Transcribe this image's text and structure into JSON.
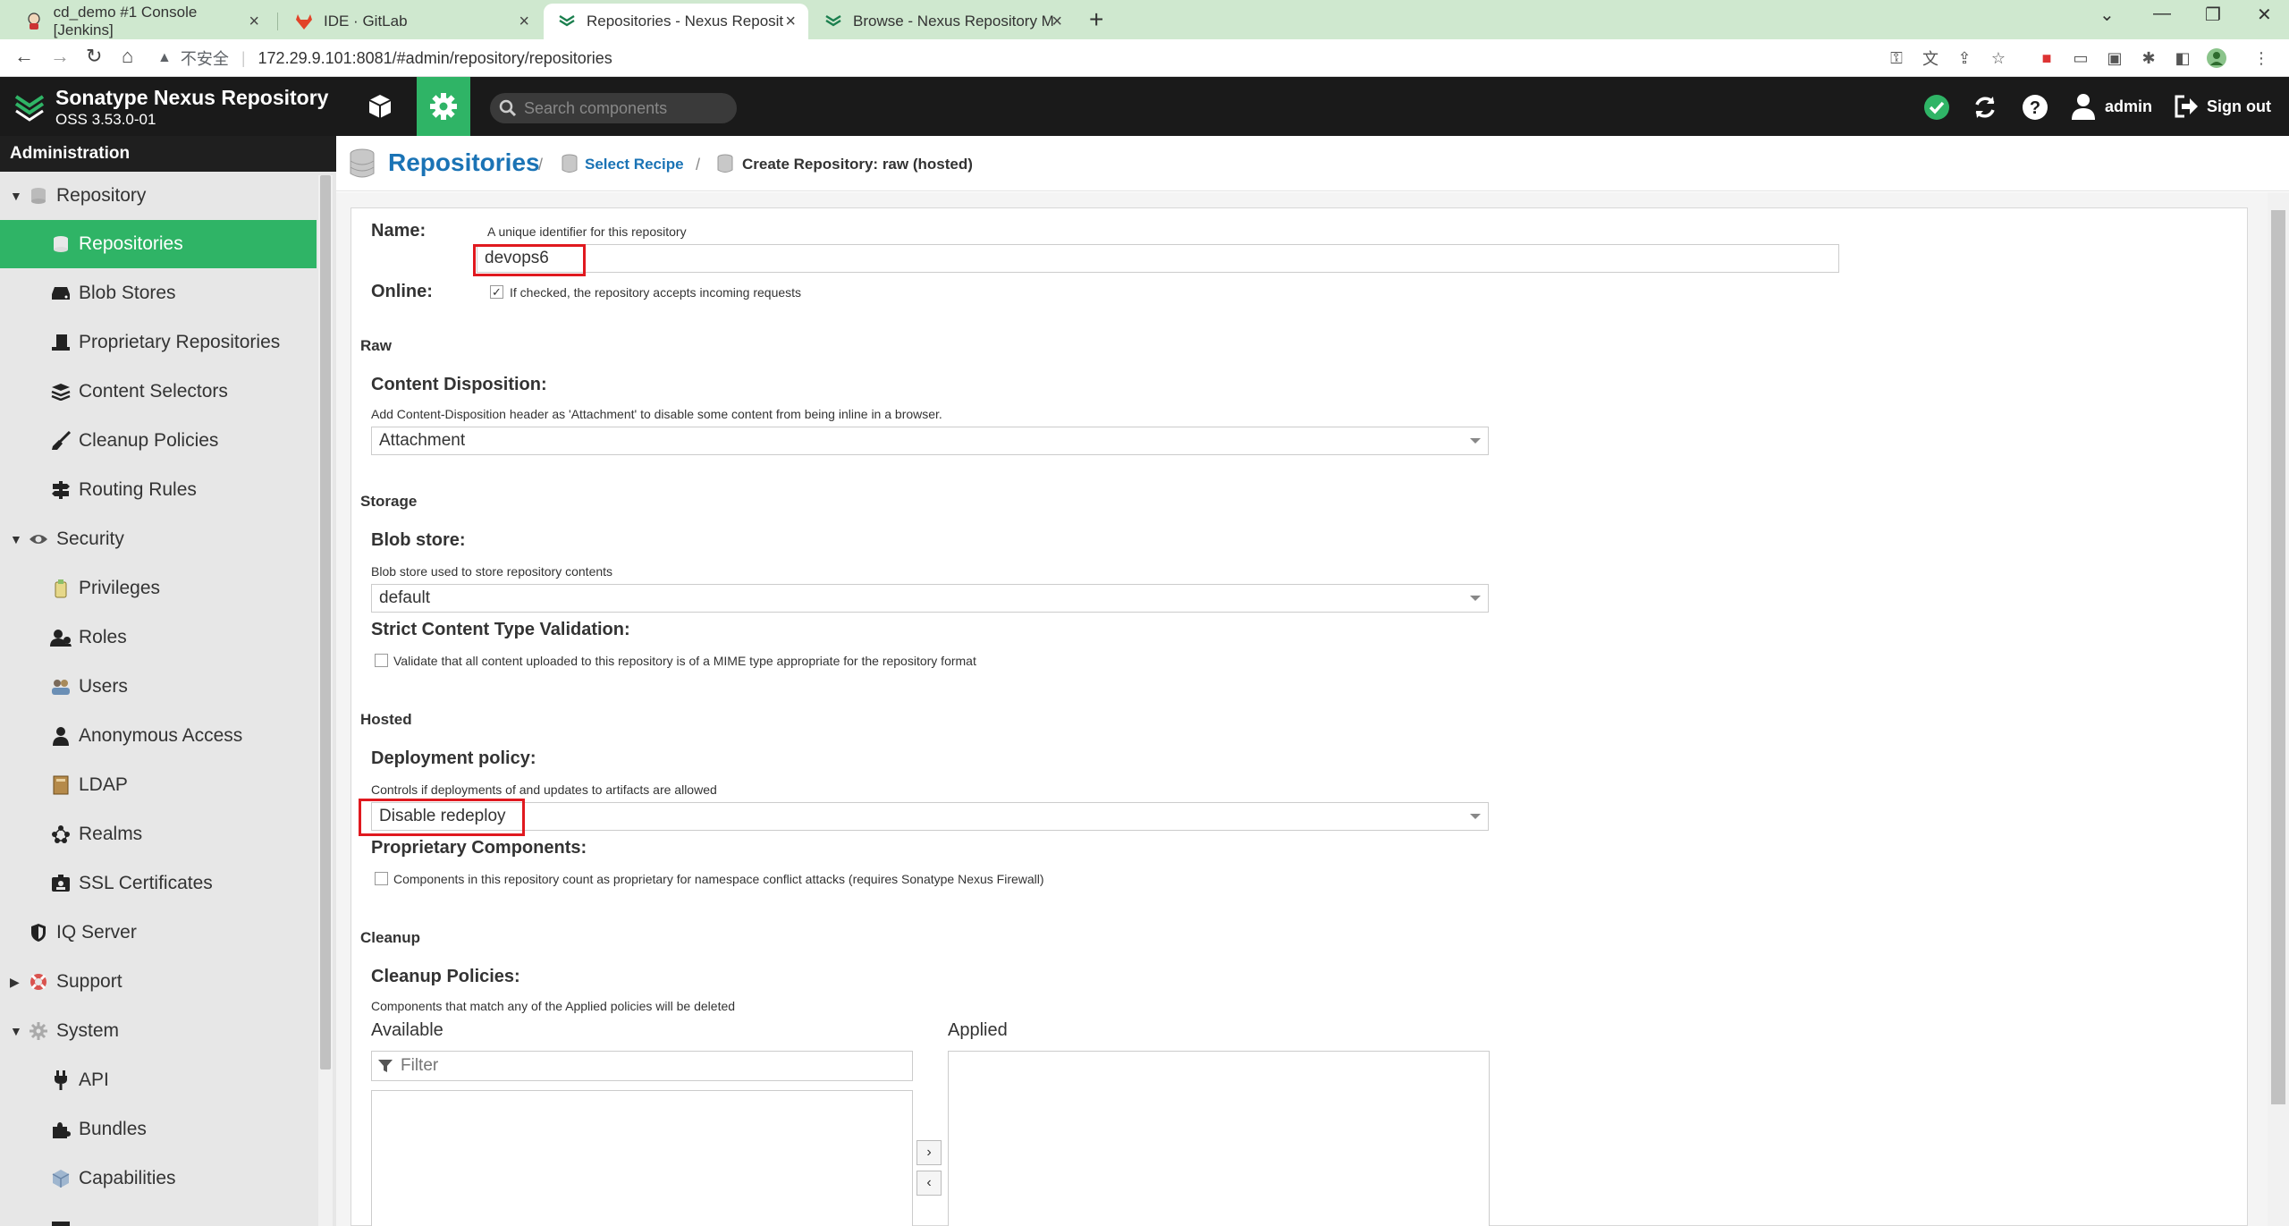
{
  "browser": {
    "tabs": [
      {
        "label": "cd_demo #1 Console [Jenkins]",
        "icon": "jenkins-icon",
        "active": false
      },
      {
        "label": "IDE · GitLab",
        "icon": "gitlab-icon",
        "active": false
      },
      {
        "label": "Repositories - Nexus Reposito",
        "icon": "nexus-icon",
        "active": true
      },
      {
        "label": "Browse - Nexus Repository Ma",
        "icon": "nexus-icon",
        "active": false
      }
    ],
    "url_prefix": "不安全",
    "url": "172.29.9.101:8081/#admin/repository/repositories"
  },
  "header": {
    "title": "Sonatype Nexus Repository",
    "version": "OSS 3.53.0-01",
    "search_placeholder": "Search components",
    "user": "admin",
    "signout": "Sign out"
  },
  "sidebar": {
    "header": "Administration",
    "items": [
      {
        "label": "Repository",
        "level": 1,
        "expanded": true,
        "icon": "database-icon"
      },
      {
        "label": "Repositories",
        "level": 2,
        "active": true,
        "icon": "database-icon"
      },
      {
        "label": "Blob Stores",
        "level": 2,
        "icon": "hard-drive-icon"
      },
      {
        "label": "Proprietary Repositories",
        "level": 2,
        "icon": "tophat-icon"
      },
      {
        "label": "Content Selectors",
        "level": 2,
        "icon": "layers-icon"
      },
      {
        "label": "Cleanup Policies",
        "level": 2,
        "icon": "broom-icon"
      },
      {
        "label": "Routing Rules",
        "level": 2,
        "icon": "signpost-icon"
      },
      {
        "label": "Security",
        "level": 1,
        "expanded": true,
        "icon": "eye-icon"
      },
      {
        "label": "Privileges",
        "level": 2,
        "icon": "badge-icon"
      },
      {
        "label": "Roles",
        "level": 2,
        "icon": "users-icon"
      },
      {
        "label": "Users",
        "level": 2,
        "icon": "user-group-icon"
      },
      {
        "label": "Anonymous Access",
        "level": 2,
        "icon": "user-icon"
      },
      {
        "label": "LDAP",
        "level": 2,
        "icon": "book-icon"
      },
      {
        "label": "Realms",
        "level": 2,
        "icon": "network-icon"
      },
      {
        "label": "SSL Certificates",
        "level": 2,
        "icon": "id-card-icon"
      },
      {
        "label": "IQ Server",
        "level": 1,
        "icon": "shield-icon"
      },
      {
        "label": "Support",
        "level": 1,
        "expanded": false,
        "icon": "lifebuoy-icon"
      },
      {
        "label": "System",
        "level": 1,
        "expanded": true,
        "icon": "gear-icon"
      },
      {
        "label": "API",
        "level": 2,
        "icon": "plug-icon"
      },
      {
        "label": "Bundles",
        "level": 2,
        "icon": "puzzle-icon"
      },
      {
        "label": "Capabilities",
        "level": 2,
        "icon": "cube-icon"
      }
    ]
  },
  "breadcrumb": {
    "root": "Repositories",
    "step": "Select Recipe",
    "current": "Create Repository: raw (hosted)"
  },
  "form": {
    "name_label": "Name:",
    "name_help": "A unique identifier for this repository",
    "name_value": "devops6",
    "online_label": "Online:",
    "online_help": "If checked, the repository accepts incoming requests",
    "raw_section": "Raw",
    "content_disposition_label": "Content Disposition:",
    "content_disposition_help": "Add Content-Disposition header as 'Attachment' to disable some content from being inline in a browser.",
    "content_disposition_value": "Attachment",
    "storage_section": "Storage",
    "blob_store_label": "Blob store:",
    "blob_store_help": "Blob store used to store repository contents",
    "blob_store_value": "default",
    "strict_label": "Strict Content Type Validation:",
    "strict_help": "Validate that all content uploaded to this repository is of a MIME type appropriate for the repository format",
    "hosted_section": "Hosted",
    "deployment_label": "Deployment policy:",
    "deployment_help": "Controls if deployments of and updates to artifacts are allowed",
    "deployment_value": "Disable redeploy",
    "proprietary_label": "Proprietary Components:",
    "proprietary_help": "Components in this repository count as proprietary for namespace conflict attacks (requires Sonatype Nexus Firewall)",
    "cleanup_section": "Cleanup",
    "cleanup_label": "Cleanup Policies:",
    "cleanup_help": "Components that match any of the Applied policies will be deleted",
    "available_label": "Available",
    "applied_label": "Applied",
    "filter_placeholder": "Filter"
  },
  "colors": {
    "accent": "#2fb466",
    "link": "#1a73b5",
    "highlight": "#e0191f"
  }
}
